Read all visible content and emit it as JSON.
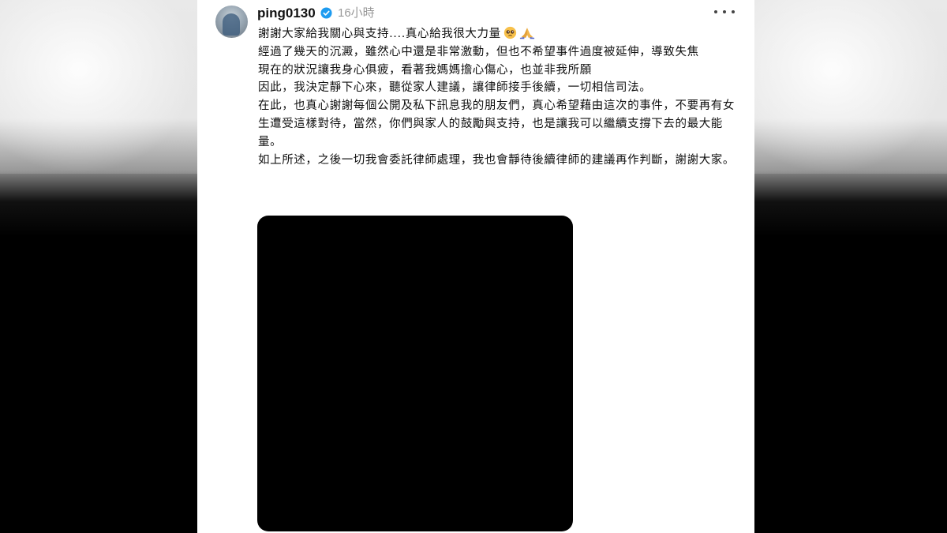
{
  "post": {
    "username": "ping0130",
    "timestamp": "16小時",
    "verified": true,
    "caption_lines": [
      "謝謝大家給我關心與支持....真心給我很大力量",
      "經過了幾天的沉澱，雖然心中還是非常激動，但也不希望事件過度被延伸，導致失焦",
      "現在的狀況讓我身心俱疲，看著我媽媽擔心傷心，也並非我所願",
      "因此，我決定靜下心來，聽從家人建議，讓律師接手後續，一切相信司法。",
      "在此，也真心謝謝每個公開及私下訊息我的朋友們，真心希望藉由這次的事件，不要再有女生遭受這樣對待，當然，你們與家人的鼓勵與支持，也是讓我可以繼續支撐下去的最大能量。",
      "如上所述，之後一切我會委託律師處理，我也會靜待後續律師的建議再作判斷，謝謝大家。"
    ],
    "icons": {
      "verified": "verified-badge-icon",
      "more": "more-options-icon",
      "emoji_1": "pleading-face-emoji",
      "emoji_2": "folded-hands-emoji"
    }
  },
  "colors": {
    "verified_blue": "#1d9bf0",
    "text": "#111111",
    "muted": "#999999"
  }
}
